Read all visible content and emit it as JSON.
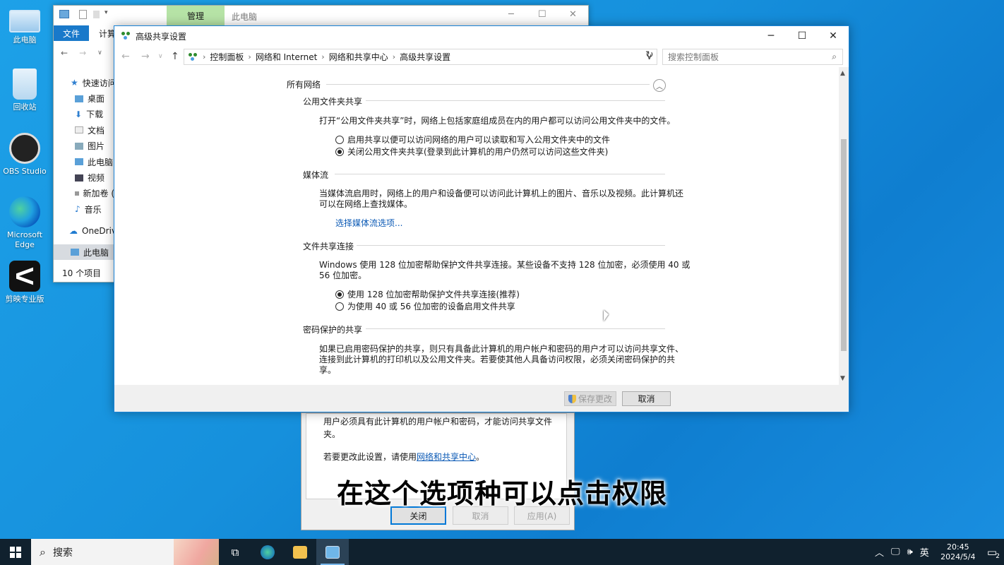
{
  "desktop": {
    "icons": [
      {
        "label": "此电脑"
      },
      {
        "label": "回收站"
      },
      {
        "label": "OBS Studio"
      },
      {
        "label_line1": "Microsoft",
        "label_line2": "Edge"
      },
      {
        "label": "剪映专业版"
      }
    ]
  },
  "explorer": {
    "manage_tab": "管理",
    "title": "此电脑",
    "file_tab": "文件",
    "computer_tab": "计算",
    "quick_access": "快速访问",
    "sidebar": [
      "桌面",
      "下载",
      "文档",
      "图片",
      "此电脑",
      "视频",
      "新加卷 (",
      "音乐"
    ],
    "onedrive": "OneDrive",
    "this_pc": "此电脑",
    "status": "10 个项目"
  },
  "properties": {
    "line1": "用户必须具有此计算机的用户帐户和密码，才能访问共享文件夹。",
    "line2_prefix": "若要更改此设置，请使用",
    "line2_link": "网络和共享中心",
    "line2_suffix": "。",
    "close_button": "关闭",
    "cancel_button": "取消",
    "apply_button": "应用(A)"
  },
  "window": {
    "title": "高级共享设置",
    "breadcrumb": [
      "控制面板",
      "网络和 Internet",
      "网络和共享中心",
      "高级共享设置"
    ],
    "search_placeholder": "搜索控制面板",
    "all_networks": "所有网络",
    "sections": {
      "public_folder": {
        "heading": "公用文件夹共享",
        "description": "打开“公用文件夹共享”时，网络上包括家庭组成员在内的用户都可以访问公用文件夹中的文件。",
        "option1": "启用共享以便可以访问网络的用户可以读取和写入公用文件夹中的文件",
        "option2": "关闭公用文件夹共享(登录到此计算机的用户仍然可以访问这些文件夹)",
        "selected": 2
      },
      "media": {
        "heading": "媒体流",
        "description_line1": "当媒体流启用时，网络上的用户和设备便可以访问此计算机上的图片、音乐以及视频。此计算机还",
        "description_line2": "可以在网络上查找媒体。",
        "link": "选择媒体流选项..."
      },
      "file_sharing": {
        "heading": "文件共享连接",
        "description_line1": "Windows 使用 128 位加密帮助保护文件共享连接。某些设备不支持 128 位加密，必须使用 40 或",
        "description_line2": "56 位加密。",
        "option1": "使用 128 位加密帮助保护文件共享连接(推荐)",
        "option2": "为使用 40 或 56 位加密的设备启用文件共享",
        "selected": 1
      },
      "password": {
        "heading": "密码保护的共享",
        "description_line1": "如果已启用密码保护的共享，则只有具备此计算机的用户帐户和密码的用户才可以访问共享文件、",
        "description_line2": "连接到此计算机的打印机以及公用文件夹。若要使其他人具备访问权限，必须关闭密码保护的共",
        "description_line3": "享。"
      }
    },
    "save_button": "保存更改",
    "cancel_button": "取消"
  },
  "caption": "在这个选项种可以点击权限",
  "taskbar": {
    "search_label": "搜索",
    "ime": "英",
    "time": "20:45",
    "date": "2024/5/4",
    "notification_count": "2"
  }
}
